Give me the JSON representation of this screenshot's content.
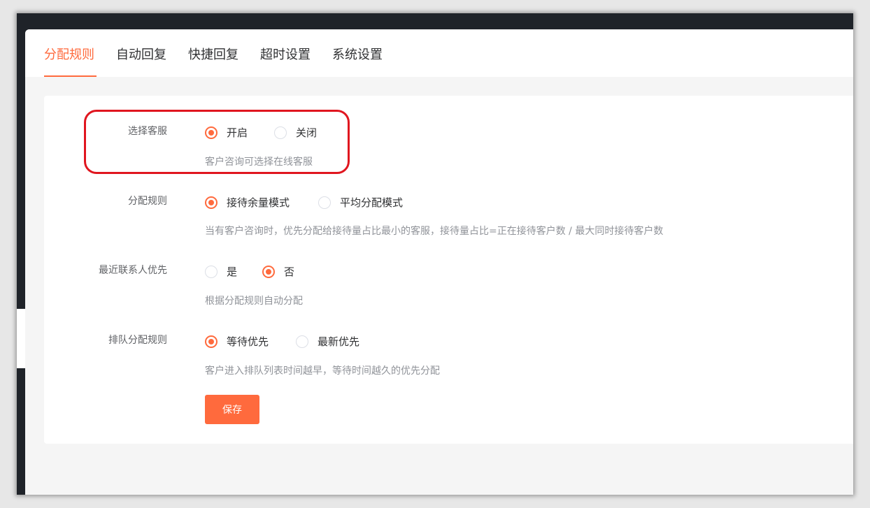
{
  "tabs": [
    {
      "label": "分配规则",
      "active": true
    },
    {
      "label": "自动回复",
      "active": false
    },
    {
      "label": "快捷回复",
      "active": false
    },
    {
      "label": "超时设置",
      "active": false
    },
    {
      "label": "系统设置",
      "active": false
    }
  ],
  "form": {
    "select_agent": {
      "label": "选择客服",
      "options": [
        "开启",
        "关闭"
      ],
      "selected": "开启",
      "hint": "客户咨询可选择在线客服"
    },
    "assign_rule": {
      "label": "分配规则",
      "options": [
        "接待余量模式",
        "平均分配模式"
      ],
      "selected": "接待余量模式",
      "hint": "当有客户咨询时，优先分配给接待量占比最小的客服，接待量占比=正在接待客户数 / 最大同时接待客户数"
    },
    "recent_contact_first": {
      "label": "最近联系人优先",
      "options": [
        "是",
        "否"
      ],
      "selected": "否",
      "hint": "根据分配规则自动分配"
    },
    "queue_rule": {
      "label": "排队分配规则",
      "options": [
        "等待优先",
        "最新优先"
      ],
      "selected": "等待优先",
      "hint": "客户进入排队列表时间越早，等待时间越久的优先分配"
    }
  },
  "save_label": "保存",
  "colors": {
    "accent": "#ff6a3d",
    "highlight": "#e0161f",
    "dark_bg": "#1f2329"
  }
}
